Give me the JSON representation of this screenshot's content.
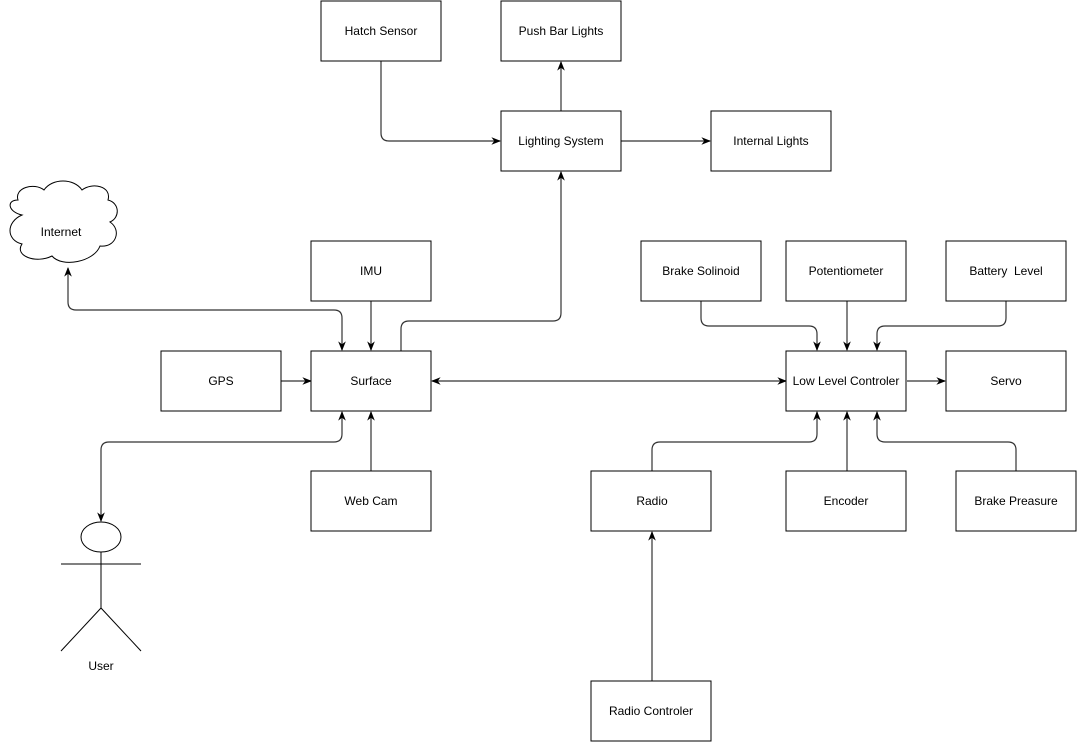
{
  "diagram": {
    "nodes": {
      "hatch_sensor": "Hatch Sensor",
      "push_bar_lights": "Push Bar Lights",
      "lighting_system": "Lighting System",
      "internal_lights": "Internal Lights",
      "internet": "Internet",
      "imu": "IMU",
      "gps": "GPS",
      "surface": "Surface",
      "web_cam": "Web Cam",
      "user": "User",
      "brake_solinoid": "Brake Solinoid",
      "potentiometer": "Potentiometer",
      "battery_level": "Battery  Level",
      "low_level_controler": "Low Level Controler",
      "servo": "Servo",
      "radio": "Radio",
      "encoder": "Encoder",
      "brake_preasure": "Brake Preasure",
      "radio_controler": "Radio Controler"
    },
    "edges": [
      {
        "from": "Hatch Sensor",
        "to": "Lighting System"
      },
      {
        "from": "Lighting System",
        "to": "Push Bar Lights"
      },
      {
        "from": "Lighting System",
        "to": "Internal Lights"
      },
      {
        "from": "Surface",
        "to": "Lighting System"
      },
      {
        "from": "Surface",
        "to": "Internet",
        "bidirectional": true
      },
      {
        "from": "IMU",
        "to": "Surface"
      },
      {
        "from": "GPS",
        "to": "Surface"
      },
      {
        "from": "Web Cam",
        "to": "Surface"
      },
      {
        "from": "Surface",
        "to": "User",
        "bidirectional": true
      },
      {
        "from": "Surface",
        "to": "Low Level Controler",
        "bidirectional": true
      },
      {
        "from": "Brake Solinoid",
        "to": "Low Level Controler"
      },
      {
        "from": "Potentiometer",
        "to": "Low Level Controler"
      },
      {
        "from": "Battery  Level",
        "to": "Low Level Controler"
      },
      {
        "from": "Low Level Controler",
        "to": "Servo"
      },
      {
        "from": "Radio",
        "to": "Low Level Controler"
      },
      {
        "from": "Encoder",
        "to": "Low Level Controler"
      },
      {
        "from": "Brake Preasure",
        "to": "Low Level Controler"
      },
      {
        "from": "Radio Controler",
        "to": "Radio"
      }
    ]
  }
}
